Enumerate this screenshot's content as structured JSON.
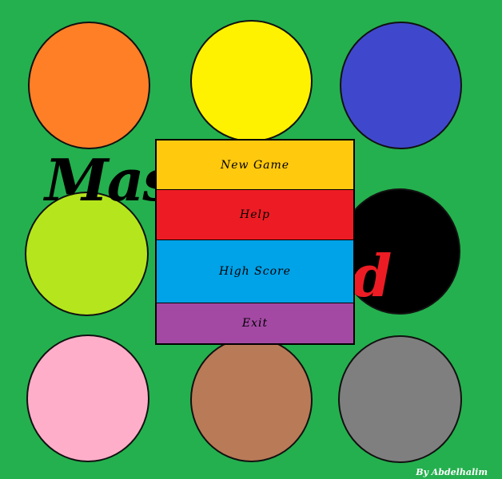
{
  "colors": {
    "background": "#24b04e",
    "orange": "#ff7f27",
    "yellow": "#fff200",
    "blue": "#3f48cc",
    "lime": "#b5e61d",
    "black": "#000000",
    "pink": "#ffaec9",
    "brown": "#b97a57",
    "gray": "#7f7f7f",
    "title_dark": "#000000",
    "title_red": "#ed1c24"
  },
  "title": {
    "left_text": "Mas",
    "right_text": "d"
  },
  "menu": {
    "items": [
      {
        "label": "New   Game",
        "color": "#ffc90e"
      },
      {
        "label": "Help",
        "color": "#ed1c24"
      },
      {
        "label": "High  Score",
        "color": "#00a2e8"
      },
      {
        "label": "Exit",
        "color": "#a349a4"
      }
    ]
  },
  "credit": "By Abdelhalim"
}
